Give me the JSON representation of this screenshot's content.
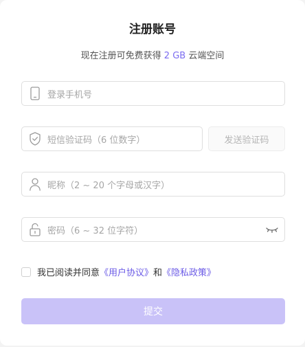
{
  "form": {
    "title": "注册账号",
    "subtitle_prefix": "现在注册可免费获得",
    "subtitle_highlight": "2 GB",
    "subtitle_suffix": "云端空间",
    "accent_color": "#7b6cf0"
  },
  "fields": {
    "phone": {
      "placeholder": "登录手机号",
      "icon": "phone-icon"
    },
    "sms_code": {
      "placeholder": "短信验证码（6 位数字）",
      "icon": "shield-check-icon"
    },
    "send_code_label": "发送验证码",
    "nickname": {
      "placeholder": "昵称（2 ~ 20 个字母或汉字）",
      "icon": "user-icon"
    },
    "password": {
      "placeholder": "密码（6 ~ 32 位字符）",
      "icon": "lock-icon",
      "toggle_icon": "eye-closed-icon"
    }
  },
  "agreement": {
    "prefix": "我已阅读并同意",
    "user_agreement": "《用户协议》",
    "and": "和",
    "privacy_policy": "《隐私政策》",
    "checked": false
  },
  "submit_label": "提交",
  "colors": {
    "submit_bg": "#c9c2f8",
    "link": "#6b5be6"
  }
}
